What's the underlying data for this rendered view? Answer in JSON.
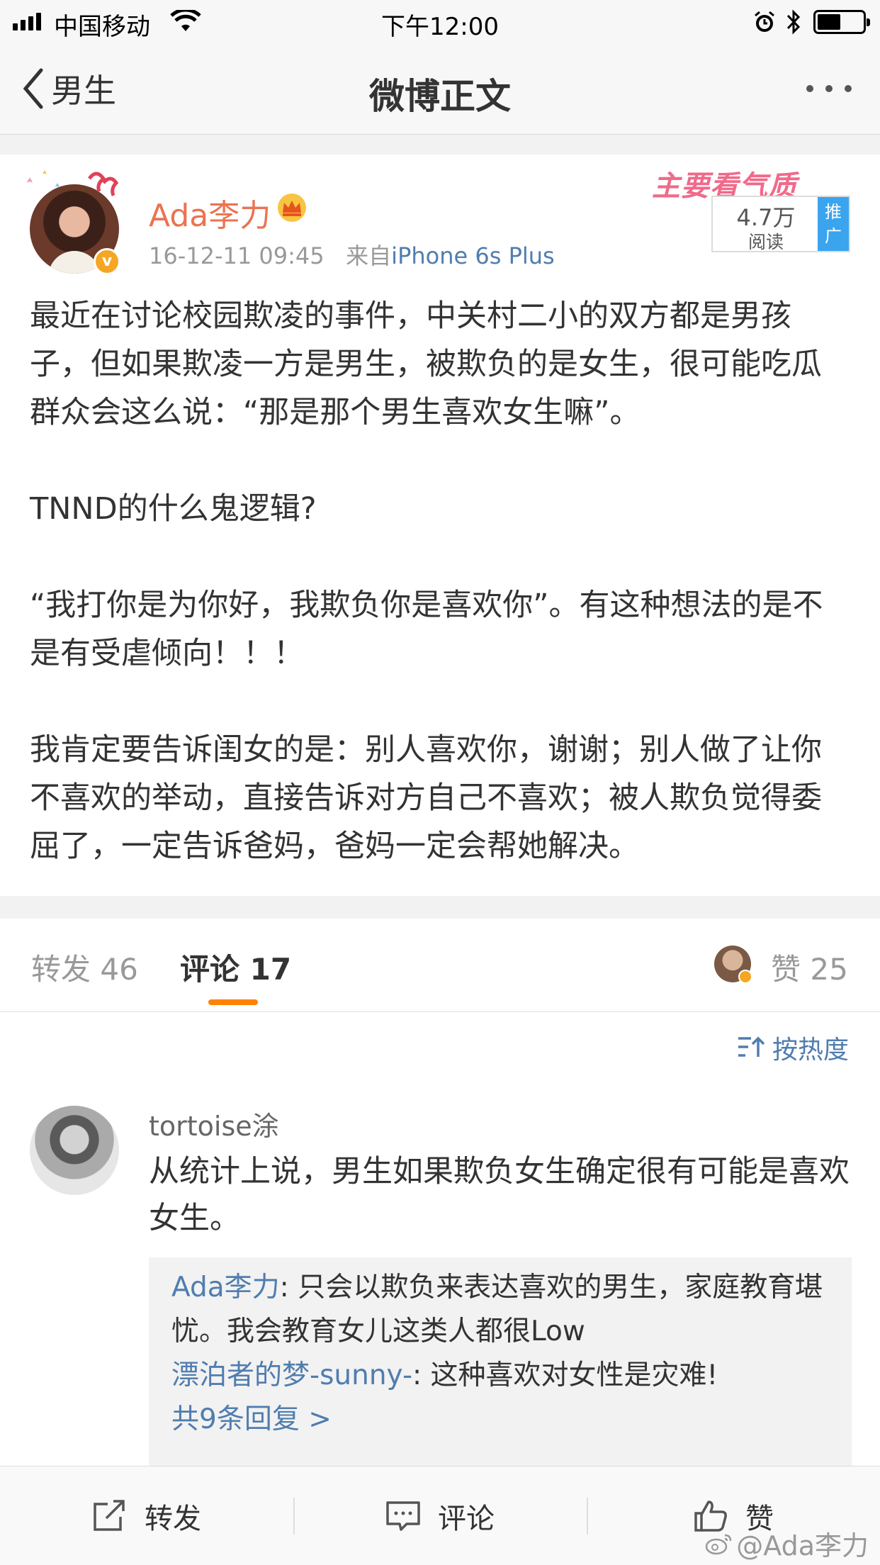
{
  "status_bar": {
    "carrier": "中国移动",
    "time": "下午12:00"
  },
  "nav": {
    "back_label": "男生",
    "title": "微博正文"
  },
  "post": {
    "username": "Ada李力",
    "date": "16-12-11 09:45",
    "source_prefix": "来自",
    "source": "iPhone 6s Plus",
    "promo_art_text": "主要看气质",
    "read_count": "4.7万",
    "read_label": "阅读",
    "promo_tag": "推广",
    "paragraphs": [
      "最近在讨论校园欺凌的事件，中关村二小的双方都是男孩子，但如果欺凌一方是男生，被欺负的是女生，很可能吃瓜群众会这么说：“那是那个男生喜欢女生嘛”。",
      "TNND的什么鬼逻辑?",
      "“我打你是为你好，我欺负你是喜欢你”。有这种想法的是不是有受虐倾向！！！",
      "我肯定要告诉闺女的是：别人喜欢你，谢谢；别人做了让你不喜欢的举动，直接告诉对方自己不喜欢；被人欺负觉得委屈了，一定告诉爸妈，爸妈一定会帮她解决。"
    ]
  },
  "tabs": {
    "repost": "转发 46",
    "comment": "评论 17",
    "like": "赞 25"
  },
  "sort_label": "按热度",
  "comment": {
    "username": "tortoise涂",
    "text": "从统计上说，男生如果欺负女生确定很有可能是喜欢女生。",
    "replies": [
      {
        "user": "Ada李力",
        "text": ": 只会以欺负来表达喜欢的男生，家庭教育堪忧。我会教育女儿这类人都很Low"
      },
      {
        "user": "漂泊者的梦-sunny-",
        "text": ": 这种喜欢对女性是灾难!"
      }
    ],
    "all_replies": "共9条回复 >"
  },
  "bottom_bar": {
    "repost": "转发",
    "comment": "评论",
    "like": "赞"
  },
  "watermark": "@Ada李力",
  "colors": {
    "username_orange": "#eb7350",
    "link_blue": "#507daf",
    "tab_underline": "#ff8200",
    "promo_blue": "#3aa4ef",
    "verified_gold": "#f5a623"
  },
  "icons": [
    "back-chevron-icon",
    "more-dots-icon",
    "wifi-icon",
    "alarm-icon",
    "bluetooth-icon",
    "battery-icon",
    "crown-icon",
    "verified-badge-icon",
    "sort-icon",
    "repost-icon",
    "comment-icon",
    "like-icon",
    "weibo-logo-icon"
  ]
}
